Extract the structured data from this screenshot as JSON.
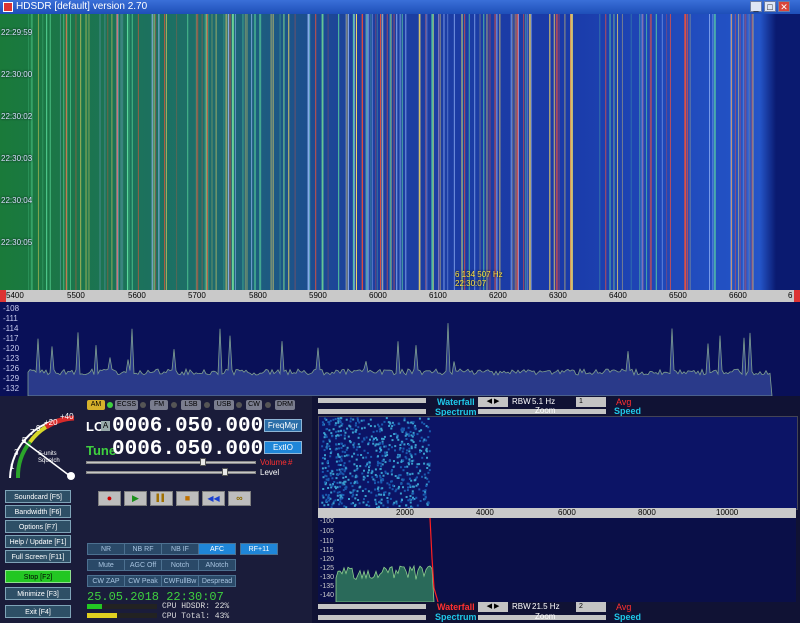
{
  "window": {
    "title": "HDSDR [default]  version 2.70",
    "minimize_glyph": "_",
    "maximize_glyph": "□",
    "close_glyph": "✕"
  },
  "waterfall": {
    "time_labels": [
      "22:29:59",
      "22:30:00",
      "22:30:02",
      "22:30:03",
      "22:30:04",
      "22:30:05"
    ],
    "cursor_freq": "6 134 507 Hz",
    "cursor_time": "22:30:07"
  },
  "freq_scale": {
    "left_edge": "5400",
    "ticks": [
      "5500",
      "5600",
      "5700",
      "5800",
      "5900",
      "6000",
      "6100",
      "6200",
      "6300",
      "6400",
      "6500",
      "6600"
    ],
    "right_edge": "6"
  },
  "spectrum": {
    "db_labels": [
      "-108",
      "-111",
      "-114",
      "-117",
      "-120",
      "-123",
      "-126",
      "-129",
      "-132"
    ]
  },
  "smeter": {
    "scale_labels": [
      "1",
      "3",
      "5",
      "7",
      "9",
      "+20",
      "+40"
    ],
    "caption": "S-units",
    "squelch": "Squelch"
  },
  "modes": [
    {
      "label": "AM",
      "active": true
    },
    {
      "label": "ECSS",
      "active": false
    },
    {
      "label": "FM",
      "active": false
    },
    {
      "label": "LSB",
      "active": false
    },
    {
      "label": "USB",
      "active": false
    },
    {
      "label": "CW",
      "active": false
    },
    {
      "label": "DRM",
      "active": false
    }
  ],
  "lo": {
    "label": "LO",
    "lock": "A",
    "value": "0006.050.000",
    "freqmgr": "FreqMgr"
  },
  "tune": {
    "label": "Tune",
    "value": "0006.050.000",
    "extio": "ExtIO"
  },
  "volume_label": "Volume",
  "level_label": "Level",
  "side_buttons": [
    {
      "label": "Soundcard  [F5]"
    },
    {
      "label": "Bandwidth  [F6]"
    },
    {
      "label": "Options    [F7]"
    },
    {
      "label": "Help / Update  [F1]"
    },
    {
      "label": "Full Screen  [F11]"
    },
    {
      "label": "Stop     [F2]"
    },
    {
      "label": "Minimize  [F3]"
    },
    {
      "label": "Exit       [F4]"
    }
  ],
  "transport": {
    "record_glyph": "●",
    "play_glyph": "▶",
    "pause_glyph": "▌▌",
    "stop_glyph": "■",
    "rewind_glyph": "◀◀",
    "loop_glyph": "∞"
  },
  "dsp_buttons": [
    {
      "label": "NR",
      "on": false
    },
    {
      "label": "NB RF",
      "on": false
    },
    {
      "label": "NB IF",
      "on": false
    },
    {
      "label": "AFC",
      "on": true
    },
    {
      "label": "RF+11",
      "on": true
    },
    {
      "label": "Mute",
      "on": false
    },
    {
      "label": "AGC Off",
      "on": false
    },
    {
      "label": "Notch",
      "on": false
    },
    {
      "label": "ANotch",
      "on": false
    },
    {
      "label": "CW ZAP",
      "on": false
    },
    {
      "label": "CW Peak",
      "on": false
    },
    {
      "label": "CWFullBw",
      "on": false
    },
    {
      "label": "Despread",
      "on": false
    }
  ],
  "status": {
    "datetime": "25.05.2018 22:30:07",
    "cpu_hdsdr": "CPU HDSDR:  22%",
    "cpu_total": "CPU Total:  43%",
    "cpu_hdsdr_fraction": 0.22,
    "cpu_total_fraction": 0.43
  },
  "upper_controls": {
    "waterfall_label": "Waterfall",
    "spectrum_label": "Spectrum",
    "rbw_label": "RBW",
    "rbw_value": "5.1 Hz",
    "avg_value": "1",
    "avg_label": "Avg",
    "zoom_label": "Zoom",
    "speed_label": "Speed"
  },
  "af_axis": {
    "x_ticks": [
      "2000",
      "4000",
      "6000",
      "8000",
      "10000"
    ],
    "db_labels": [
      "-100",
      "-105",
      "-110",
      "-115",
      "-120",
      "-125",
      "-130",
      "-135",
      "-140"
    ]
  },
  "lower_controls": {
    "waterfall_label": "Waterfall",
    "spectrum_label": "Spectrum",
    "rbw_label": "RBW",
    "rbw_value": "21.5 Hz",
    "avg_value": "2",
    "avg_label": "Avg",
    "zoom_label": "Zoom",
    "speed_label": "Speed"
  },
  "colors": {
    "accent_blue": "#1f86d8",
    "stop_green": "#23c723",
    "cursor_yellow": "#ffe040",
    "red_label": "#ff3030"
  }
}
